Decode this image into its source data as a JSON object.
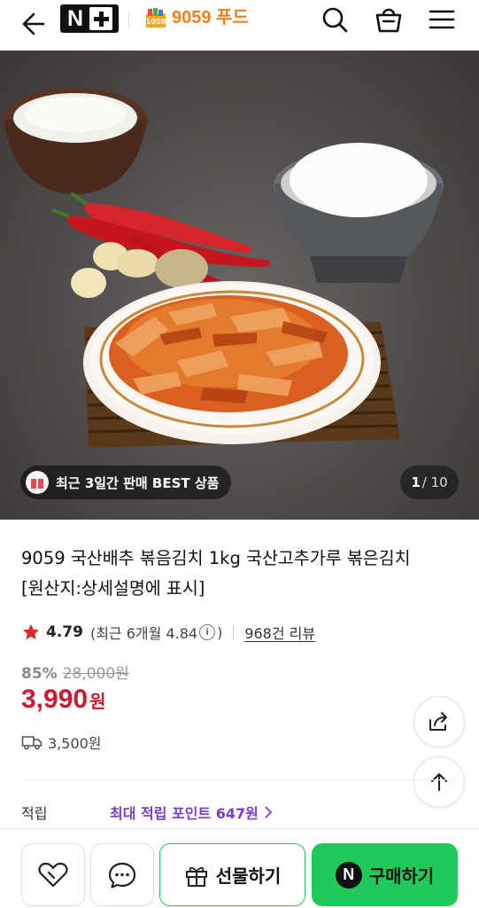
{
  "header": {
    "brand_logo_text": "N+",
    "store_logo_text": "1059",
    "store_name": "9059 푸드",
    "icons": [
      "back-arrow-icon",
      "search-icon",
      "shopping-bag-icon",
      "menu-icon"
    ]
  },
  "hero": {
    "badge_text": "최근 3일간 판매 BEST 상품",
    "badge_icon": "gift-icon",
    "pager_current": "1",
    "pager_total": "/ 10"
  },
  "product": {
    "title": "9059 국산배추 볶음김치 1kg 국산고추가루 볶은김치 [원산지:상세설명에 표시]",
    "rating": "4.79",
    "recent_rating_open": "(최근 6개월 4.84",
    "recent_rating_close": ")",
    "info_icon_text": "i",
    "review_count": "968건 리뷰",
    "discount": "85%",
    "original_price": "28,000원",
    "price": "3,990",
    "price_unit": "원",
    "shipping": "3,500원"
  },
  "points": {
    "label": "적립",
    "value": "최대 적립 포인트 647원"
  },
  "bottom_bar": {
    "gift_label": "선물하기",
    "buy_label": "구매하기",
    "buy_logo": "N"
  },
  "colors": {
    "accent_green": "#21c85a",
    "price_red": "#d0182f",
    "points_purple": "#7a3bd3",
    "store_orange": "#f07f1a"
  }
}
